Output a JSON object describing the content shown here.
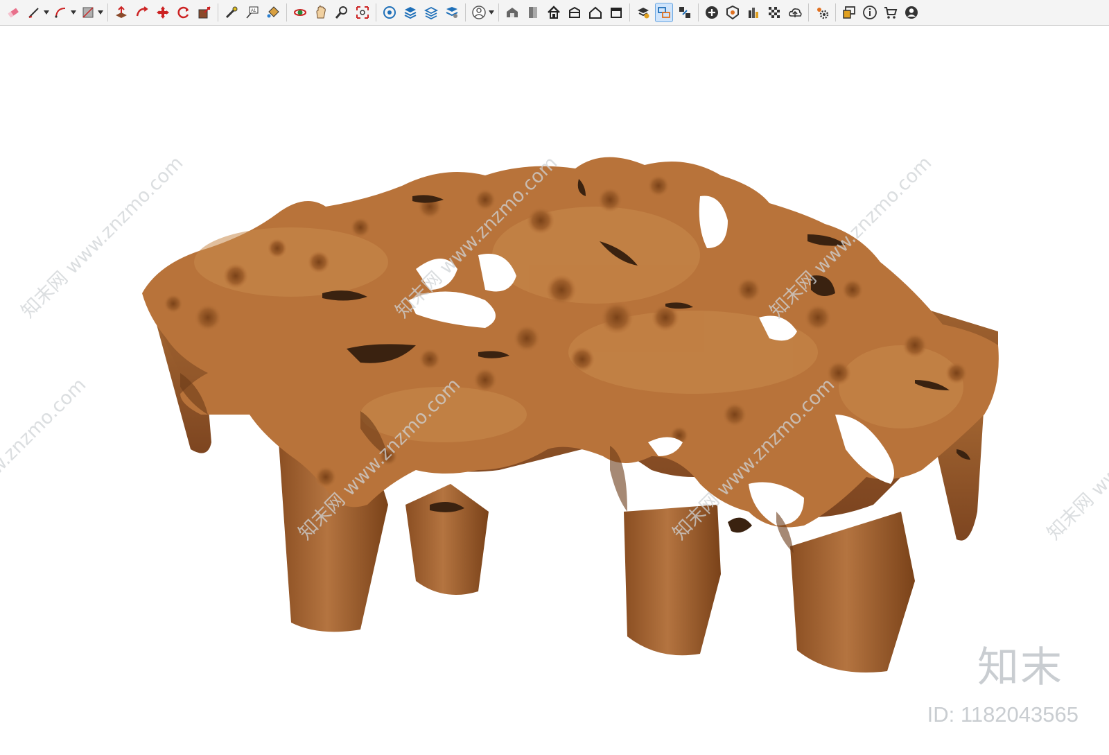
{
  "toolbar": {
    "groups": [
      [
        "eraser-icon",
        "pencil-icon",
        "arc-icon",
        "shape-icon"
      ],
      [
        "push-pull-icon",
        "follow-me-icon",
        "move-icon",
        "rotate-icon",
        "scale-icon"
      ],
      [
        "tape-measure-icon",
        "text-label-icon",
        "paint-bucket-icon"
      ],
      [
        "orbit-icon",
        "pan-icon",
        "zoom-icon",
        "zoom-extents-icon"
      ],
      [
        "section-plane-icon",
        "layers-icon",
        "styles-icon",
        "scenes-icon"
      ],
      [
        "user-account-icon"
      ],
      [
        "warehouse-icon",
        "component-icon",
        "home-icon",
        "iso-view-icon",
        "front-view-icon",
        "side-view-icon"
      ],
      [
        "solid-tools-icon",
        "outliner-icon",
        "entity-info-icon"
      ],
      [
        "add-location-icon",
        "sandbox-icon",
        "shadows-icon",
        "fog-icon",
        "cloud-upload-icon"
      ],
      [
        "extension-settings-icon"
      ],
      [
        "dialog-icon",
        "instructor-info-icon",
        "cart-icon",
        "profile-icon"
      ]
    ],
    "active_tool": "outliner-icon"
  },
  "watermark": {
    "diagonal_text": "知末网 www.znzmo.com",
    "brand": "知末",
    "id_label": "ID: 1182043565"
  },
  "model": {
    "name": "root-wood-coffee-table",
    "colors": {
      "top": "#b8733a",
      "top_light": "#c98a4c",
      "side": "#9a5a28",
      "dark": "#6b3a17",
      "hole": "#3a2210"
    }
  }
}
